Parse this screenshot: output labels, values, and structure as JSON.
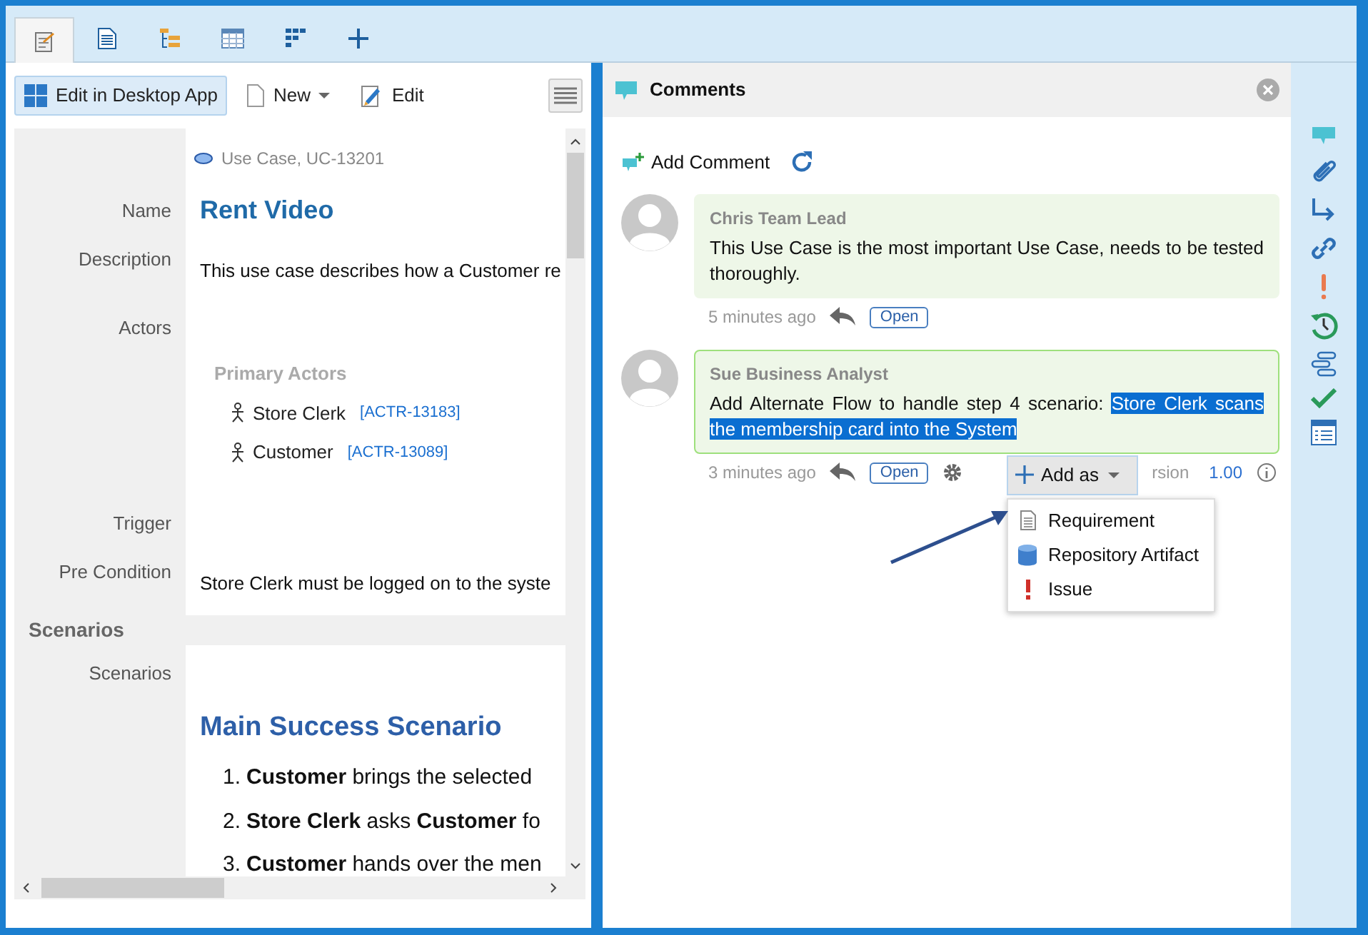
{
  "tabs": [
    {
      "kind": "edit",
      "selected": true
    },
    {
      "kind": "document",
      "selected": false
    },
    {
      "kind": "tree",
      "selected": false
    },
    {
      "kind": "table",
      "selected": false
    },
    {
      "kind": "grid",
      "selected": false
    }
  ],
  "toolbar": {
    "desktop_button": "Edit in Desktop App",
    "new_button": "New",
    "edit_button": "Edit"
  },
  "element": {
    "type_label": "Use Case, UC-13201",
    "fields": [
      {
        "label": "Name",
        "kind": "title",
        "value": "Rent Video"
      },
      {
        "label": "Description",
        "kind": "text",
        "value": "This use case describes how a Customer re"
      },
      {
        "label": "Actors",
        "kind": "actors",
        "heading": "Primary Actors",
        "actors": [
          {
            "name": "Store Clerk",
            "id": "[ACTR-13183]"
          },
          {
            "name": "Customer",
            "id": "[ACTR-13089]"
          }
        ]
      },
      {
        "label": "Trigger",
        "kind": "empty"
      },
      {
        "label": "Pre Condition",
        "kind": "text",
        "value": "Store Clerk must be logged on to the syste"
      }
    ],
    "section": "Scenarios",
    "scenarios": {
      "label": "Scenarios",
      "heading": "Main Success Scenario",
      "steps": [
        {
          "number": "1.",
          "text": "**Customer** brings the selected"
        },
        {
          "number": "2.",
          "text": "**Store Clerk** asks **Customer** fo"
        },
        {
          "number": "3.",
          "text": "**Customer** hands over the men"
        }
      ]
    }
  },
  "comments_panel": {
    "title": "Comments",
    "add_comment": "Add Comment",
    "comments": [
      {
        "author": "Chris Team Lead",
        "text": "This Use Case is the most important Use Case, needs to be tested thoroughly.",
        "time": "5 minutes ago",
        "status": "Open",
        "settings": false,
        "active": false
      },
      {
        "author": "Sue Business Analyst",
        "text": "Add Alternate Flow to handle step 4 scenario: ",
        "highlighted": "Store Clerk scans the membership card into the System",
        "time": "3 minutes ago",
        "status": "Open",
        "settings": true,
        "version_label": "rsion",
        "version": "1.00",
        "active": true
      }
    ],
    "add_as": {
      "label": "Add as",
      "items": [
        {
          "kind": "requirement",
          "label": "Requirement"
        },
        {
          "kind": "artifact",
          "label": "Repository Artifact"
        },
        {
          "kind": "issue",
          "label": "Issue"
        }
      ]
    }
  }
}
